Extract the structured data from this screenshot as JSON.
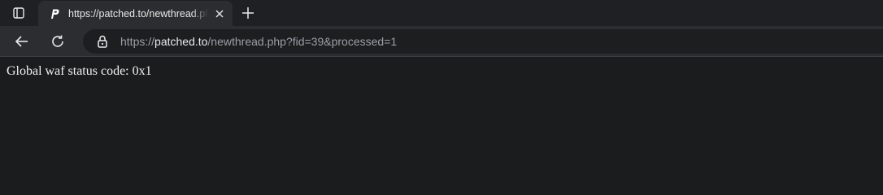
{
  "tab": {
    "title": "https://patched.to/newthread.php",
    "favicon": "patched-p-logo-icon",
    "close_icon": "close-icon"
  },
  "tabstrip": {
    "tab_actions_icon": "tab-actions-menu-icon",
    "new_tab_icon": "plus-icon"
  },
  "toolbar": {
    "back_icon": "arrow-left-icon",
    "reload_icon": "reload-icon",
    "lock_icon": "lock-icon"
  },
  "address_bar": {
    "scheme": "https://",
    "host": "patched.to",
    "path": "/newthread.php?fid=39&processed=1"
  },
  "page": {
    "message": "Global waf status code: 0x1"
  },
  "colors": {
    "page_background": "#1b1c1e",
    "toolbar_background": "#2c2d30",
    "text": "#f1f1f1"
  }
}
